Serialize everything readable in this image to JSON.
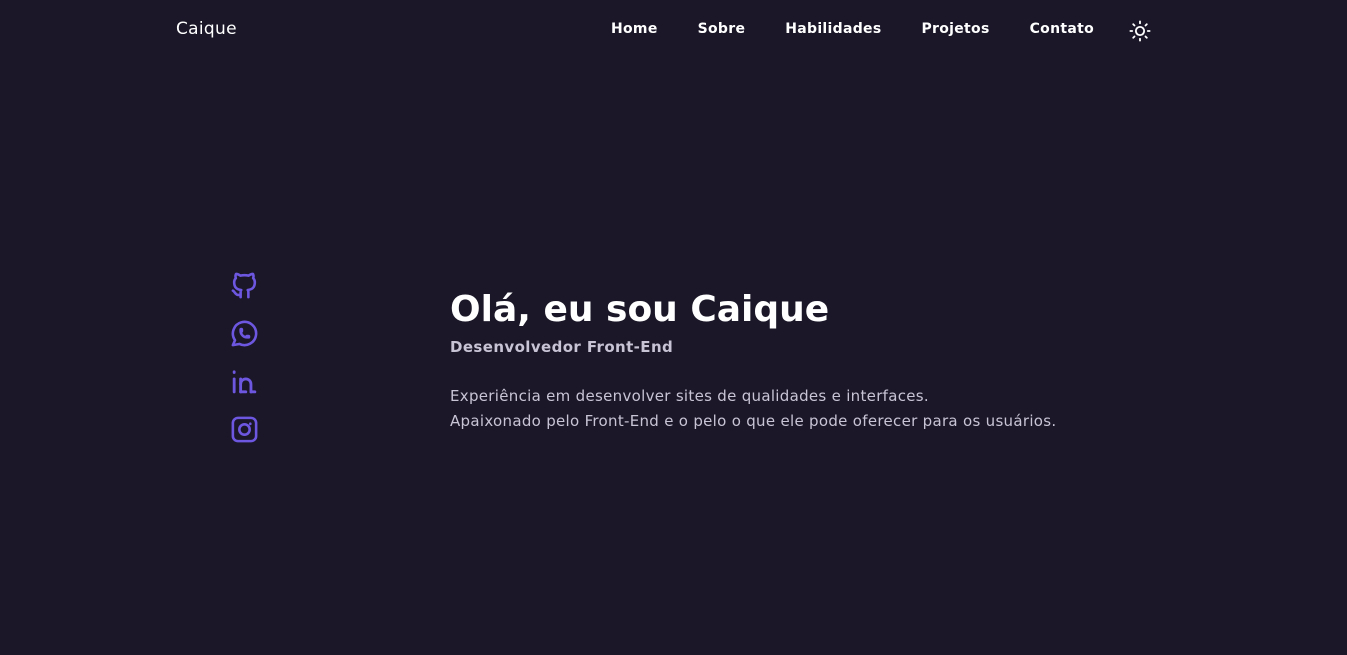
{
  "header": {
    "logo": "Caique",
    "nav": [
      "Home",
      "Sobre",
      "Habilidades",
      "Projetos",
      "Contato"
    ],
    "theme_icon": "sun-icon"
  },
  "socials": [
    {
      "name": "github-icon"
    },
    {
      "name": "whatsapp-icon"
    },
    {
      "name": "linkedin-icon"
    },
    {
      "name": "instagram-icon"
    }
  ],
  "hero": {
    "title": "Olá, eu sou Caique",
    "subtitle": "Desenvolvedor Front-End",
    "description_line1": "Experiência em desenvolver sites de qualidades e interfaces.",
    "description_line2": "Apaixonado pelo Front-End e o pelo o que ele pode oferecer para os usuários."
  },
  "colors": {
    "background": "#1b1728",
    "accent": "#6e57e0",
    "text": "#ffffff",
    "muted_text": "#c8c4d6"
  }
}
